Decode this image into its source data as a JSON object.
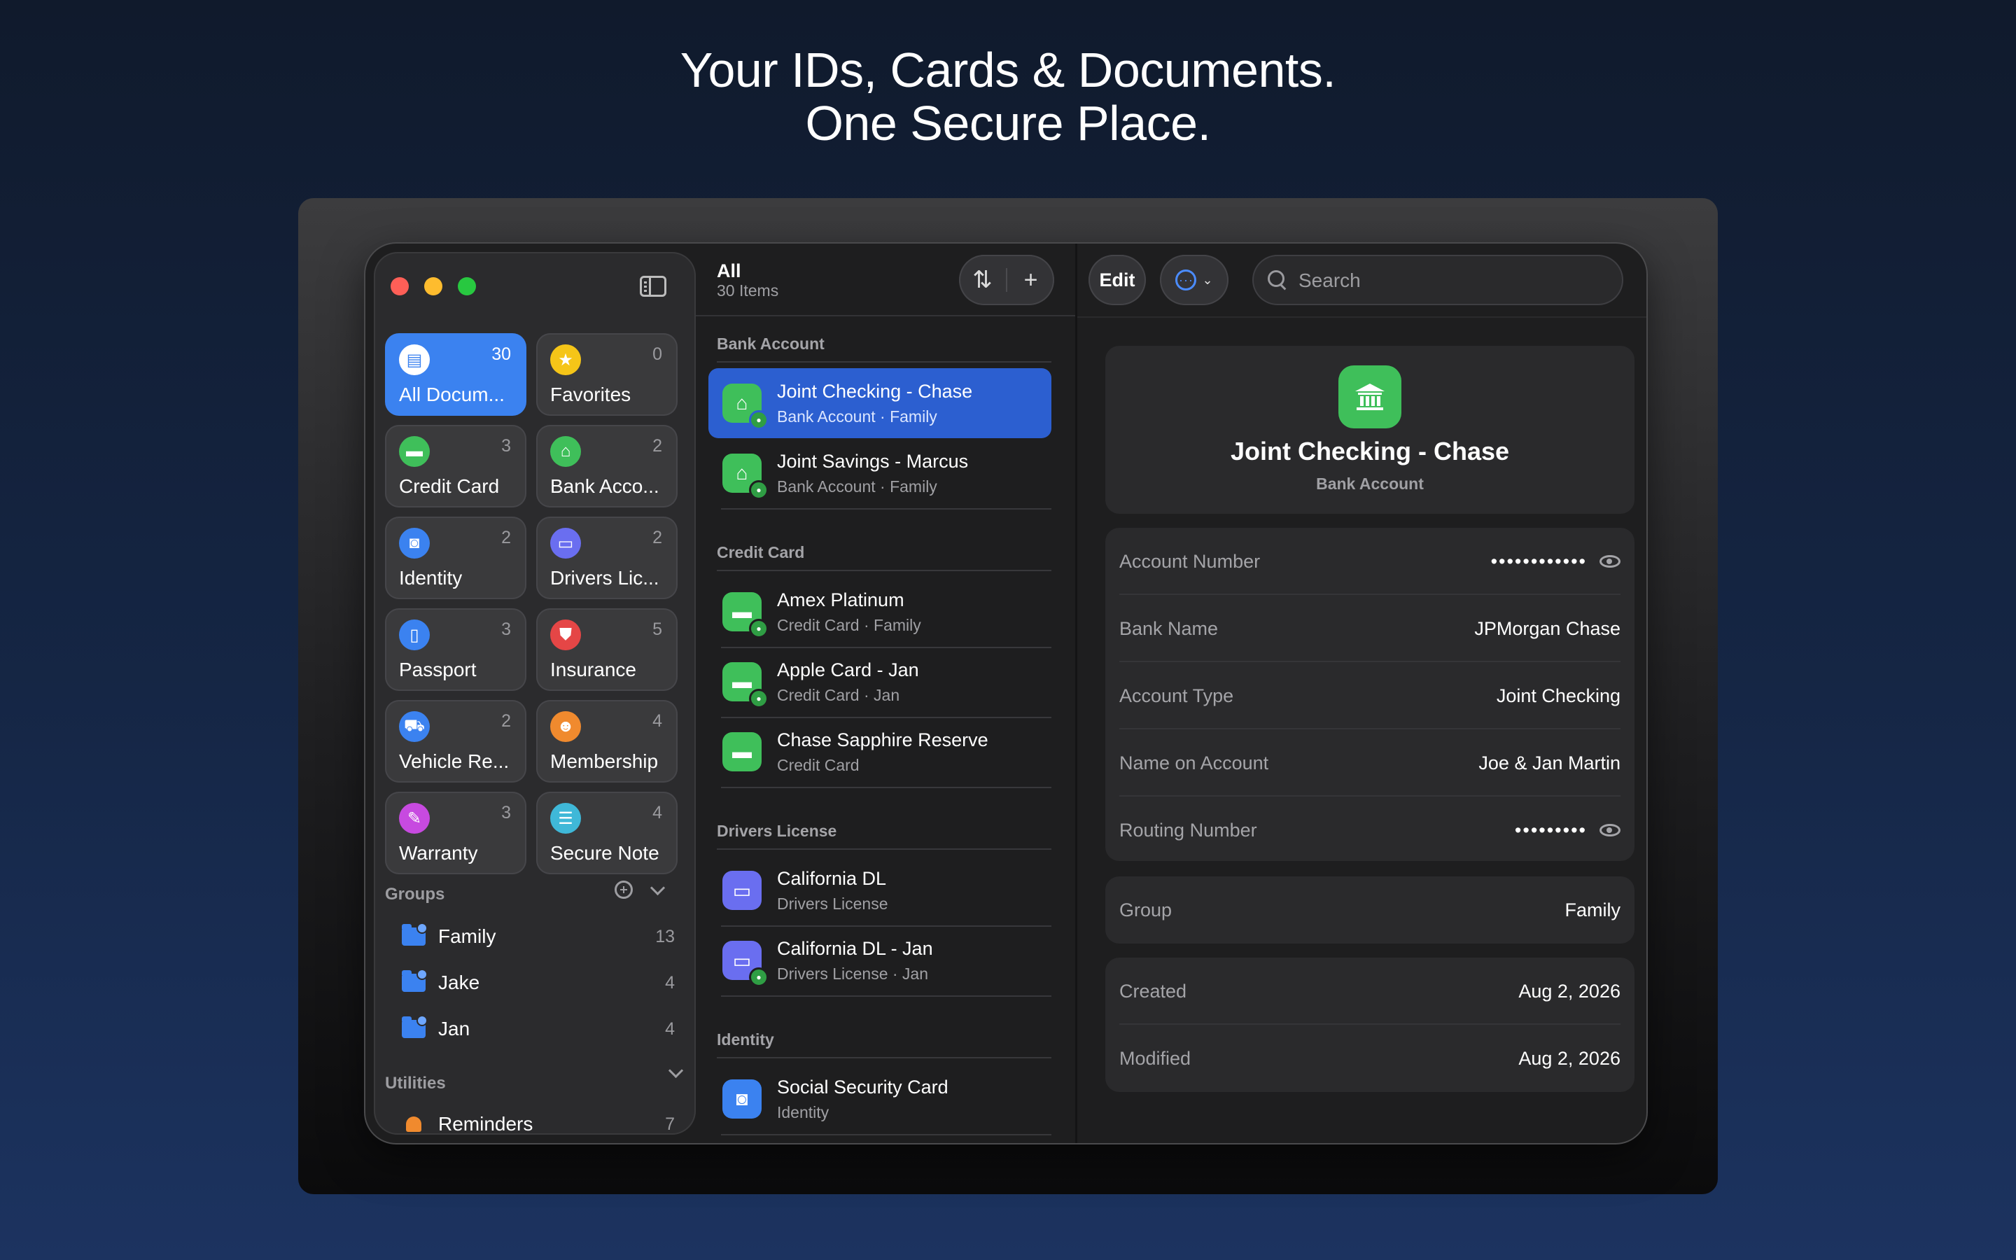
{
  "headline": {
    "line1": "Your IDs, Cards & Documents.",
    "line2": "One Secure Place."
  },
  "colors": {
    "accent": "#3b82f0",
    "selected_row": "#2c5fd0",
    "bank_green": "#3fbf5a",
    "window_bg": "#1e1e1f"
  },
  "sidebar": {
    "toggle_icon": "sidebar-toggle-icon",
    "tiles": [
      {
        "label": "All Docum...",
        "count": "30",
        "icon": "document-icon",
        "color": "#ffffff",
        "active": true
      },
      {
        "label": "Favorites",
        "count": "0",
        "icon": "star-icon",
        "color": "#f5c518"
      },
      {
        "label": "Credit Card",
        "count": "3",
        "icon": "credit-card-icon",
        "color": "#3fbf5a"
      },
      {
        "label": "Bank Acco...",
        "count": "2",
        "icon": "bank-icon",
        "color": "#3fbf5a"
      },
      {
        "label": "Identity",
        "count": "2",
        "icon": "id-badge-icon",
        "color": "#3b82f0"
      },
      {
        "label": "Drivers Lic...",
        "count": "2",
        "icon": "license-icon",
        "color": "#6a6ef0"
      },
      {
        "label": "Passport",
        "count": "3",
        "icon": "passport-icon",
        "color": "#3b82f0"
      },
      {
        "label": "Insurance",
        "count": "5",
        "icon": "shield-icon",
        "color": "#e54646"
      },
      {
        "label": "Vehicle Re...",
        "count": "2",
        "icon": "car-icon",
        "color": "#3b82f0"
      },
      {
        "label": "Membership",
        "count": "4",
        "icon": "people-icon",
        "color": "#f08a2e"
      },
      {
        "label": "Warranty",
        "count": "3",
        "icon": "warranty-icon",
        "color": "#c74ae0"
      },
      {
        "label": "Secure Note",
        "count": "4",
        "icon": "note-icon",
        "color": "#3fb8d8"
      }
    ],
    "groups_header": "Groups",
    "groups": [
      {
        "name": "Family",
        "count": "13"
      },
      {
        "name": "Jake",
        "count": "4"
      },
      {
        "name": "Jan",
        "count": "4"
      }
    ],
    "utilities_header": "Utilities",
    "utilities": [
      {
        "name": "Reminders",
        "count": "7",
        "icon": "bell-icon"
      }
    ]
  },
  "list": {
    "title": "All",
    "subtitle": "30 Items",
    "sort_icon": "sort-arrows-icon",
    "add_icon": "plus-icon",
    "sections": [
      {
        "name": "Bank Account",
        "items": [
          {
            "title": "Joint Checking - Chase",
            "subtitle": "Bank Account · Family",
            "icon": "bank-icon",
            "color": "#3fbf5a",
            "shared": true,
            "selected": true
          },
          {
            "title": "Joint Savings - Marcus",
            "subtitle": "Bank Account · Family",
            "icon": "bank-icon",
            "color": "#3fbf5a",
            "shared": true
          }
        ]
      },
      {
        "name": "Credit Card",
        "items": [
          {
            "title": "Amex Platinum",
            "subtitle": "Credit Card · Family",
            "icon": "credit-card-icon",
            "color": "#3fbf5a",
            "shared": true
          },
          {
            "title": "Apple Card - Jan",
            "subtitle": "Credit Card · Jan",
            "icon": "credit-card-icon",
            "color": "#3fbf5a",
            "shared": true
          },
          {
            "title": "Chase Sapphire Reserve",
            "subtitle": "Credit Card",
            "icon": "credit-card-icon",
            "color": "#3fbf5a",
            "shared": false
          }
        ]
      },
      {
        "name": "Drivers License",
        "items": [
          {
            "title": "California DL",
            "subtitle": "Drivers License",
            "icon": "license-icon",
            "color": "#6a6ef0",
            "shared": false
          },
          {
            "title": "California DL - Jan",
            "subtitle": "Drivers License · Jan",
            "icon": "license-icon",
            "color": "#6a6ef0",
            "shared": true
          }
        ]
      },
      {
        "name": "Identity",
        "items": [
          {
            "title": "Social Security Card",
            "subtitle": "Identity",
            "icon": "id-badge-icon",
            "color": "#3b82f0",
            "shared": false
          }
        ]
      }
    ]
  },
  "detail": {
    "edit_label": "Edit",
    "more_icon": "ellipsis-circle-icon",
    "search_placeholder": "Search",
    "title": "Joint Checking - Chase",
    "type": "Bank Account",
    "fields": [
      {
        "label": "Account Number",
        "value": "••••••••••••",
        "masked": true
      },
      {
        "label": "Bank Name",
        "value": "JPMorgan Chase"
      },
      {
        "label": "Account Type",
        "value": "Joint Checking"
      },
      {
        "label": "Name on Account",
        "value": "Joe & Jan Martin"
      },
      {
        "label": "Routing Number",
        "value": "•••••••••",
        "masked": true
      }
    ],
    "group_label": "Group",
    "group_value": "Family",
    "created_label": "Created",
    "created_value": "Aug 2, 2026",
    "modified_label": "Modified",
    "modified_value": "Aug 2, 2026"
  }
}
